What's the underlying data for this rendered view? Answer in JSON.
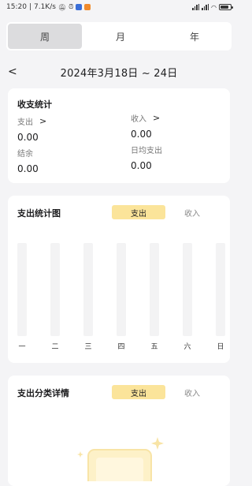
{
  "status_bar": {
    "time": "15:20",
    "speed": "7.1K/s",
    "separator": "|",
    "battery_percent": 85
  },
  "period_tabs": [
    {
      "label": "周",
      "active": true
    },
    {
      "label": "月",
      "active": false
    },
    {
      "label": "年",
      "active": false
    }
  ],
  "date_range": {
    "back_glyph": "<",
    "text": "2024年3月18日 ~ 24日"
  },
  "summary": {
    "title": "收支统计",
    "expense_label": "支出",
    "expense_value": "0.00",
    "income_label": "收入",
    "income_value": "0.00",
    "balance_label": "结余",
    "balance_value": "0.00",
    "daily_avg_label": "日均支出",
    "daily_avg_value": "0.00",
    "chevron": ">"
  },
  "expense_chart": {
    "title": "支出统计图",
    "toggle": {
      "expense": "支出",
      "income": "收入",
      "selected": "expense"
    }
  },
  "chart_data": {
    "type": "bar",
    "categories": [
      "一",
      "二",
      "三",
      "四",
      "五",
      "六",
      "日"
    ],
    "values": [
      0,
      0,
      0,
      0,
      0,
      0,
      0
    ]
  },
  "category_detail": {
    "title": "支出分类详情",
    "toggle": {
      "expense": "支出",
      "income": "收入",
      "selected": "expense"
    }
  },
  "colors": {
    "accent": "#fbe49a",
    "bar_track": "#f3f3f4",
    "background": "#f4f4f6"
  }
}
